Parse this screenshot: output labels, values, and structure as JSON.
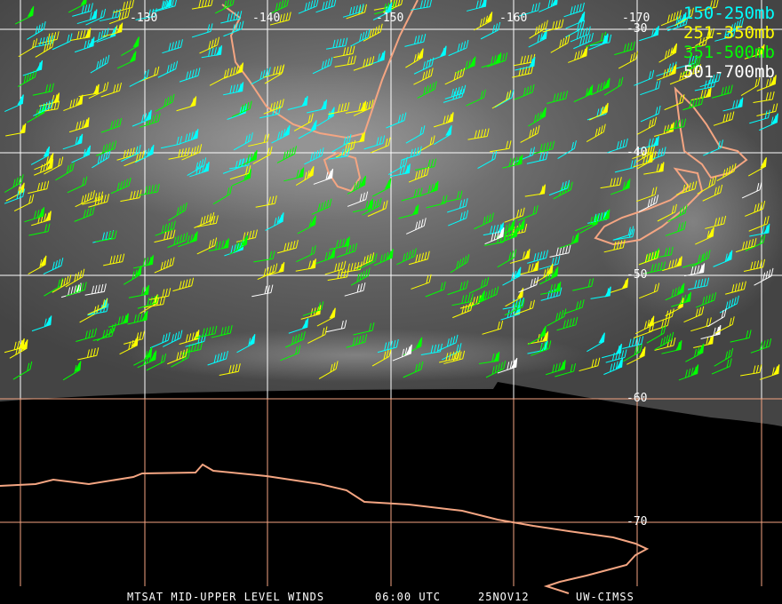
{
  "legend": [
    {
      "label": "150-250mb",
      "color": "#00ffff"
    },
    {
      "label": "251-350mb",
      "color": "#ffff00"
    },
    {
      "label": "351-500mb",
      "color": "#00ff00"
    },
    {
      "label": "501-700mb",
      "color": "#ffffff"
    }
  ],
  "longitude_labels": [
    "-130",
    "-140",
    "-150",
    "-160",
    "-170"
  ],
  "latitude_labels": [
    "-30",
    "-40",
    "-50",
    "-60",
    "-70"
  ],
  "caption": {
    "title": "MTSAT MID-UPPER LEVEL WINDS",
    "time": "06:00 UTC",
    "date": "25NOV12",
    "source": "UW-CIMSS"
  },
  "colors": {
    "grid": "#ffffff",
    "coast": "#f4a582",
    "earth_edge": "#000000"
  }
}
